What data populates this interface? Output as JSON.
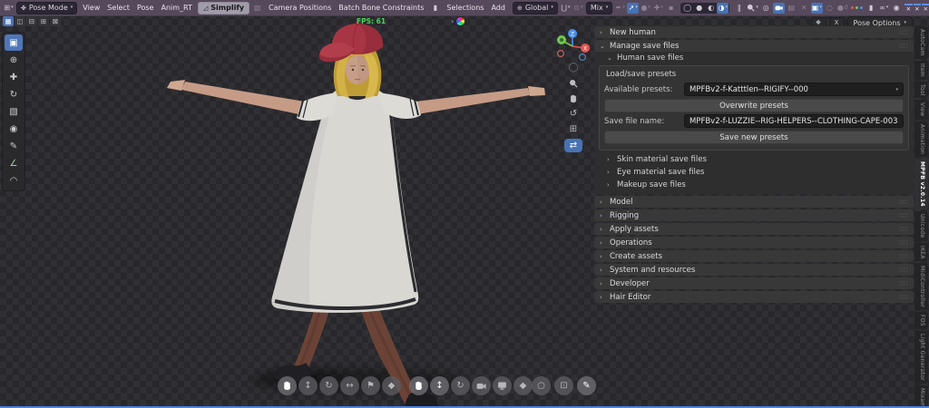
{
  "colors": {
    "accent_blue": "#4772b3",
    "header_bg": "#57495c",
    "fps_green": "#4bd45c",
    "viewport_checker_dark": "#28282c",
    "viewport_checker_light": "#303034",
    "panel_section_bg": "#383838",
    "bottom_edge_blue": "#4d82dd",
    "cap_red": "#a83543",
    "hair_blonde": "#d2b246",
    "dress_white": "#d8d7d2"
  },
  "glyphs": {
    "caret": "▾",
    "collapsed": "›",
    "expanded": "⌄"
  },
  "header": {
    "editor_icon": {
      "name": "editor-type-icon",
      "glyph": "⊞",
      "caret": true
    },
    "mode_label": "Pose Mode",
    "mode_icon_glyph": "✤",
    "menus": [
      "View",
      "Select",
      "Pose",
      "Anim_RT"
    ],
    "simplify_label": "Simplify",
    "simplify_icon_glyph": "◿",
    "menus2": [
      "Camera Positions",
      "Batch Bone Constraints"
    ],
    "bookmark_glyph": "▮",
    "menus3": [
      "Selections",
      "Add"
    ],
    "orientation_label": "Global",
    "orientation_icon_glyph": "⊕",
    "mix_label": "Mix",
    "icons_a": [
      {
        "name": "snap-magnet-icon",
        "glyph": "⋃",
        "caret": true
      },
      {
        "name": "proportional-edit-icon",
        "glyph": "⊙",
        "dim": true,
        "caret": true
      }
    ],
    "icons_b": [
      {
        "name": "eyedropper-icon",
        "glyph": "✒",
        "dim": true,
        "caret": true
      },
      {
        "name": "gizmo-toggle-icon",
        "glyph": "➚",
        "active": true,
        "caret": true
      },
      {
        "name": "sphere-icon",
        "glyph": "●",
        "dim": true,
        "caret": true
      },
      {
        "name": "overlay-cross-icon",
        "glyph": "✚",
        "dim": true,
        "caret": true
      },
      {
        "name": "disabled-box-icon",
        "glyph": "▪",
        "dim": true
      }
    ],
    "shading": [
      {
        "name": "shading-wireframe-icon",
        "glyph": "◯"
      },
      {
        "name": "shading-solid-icon",
        "glyph": "●"
      },
      {
        "name": "shading-material-icon",
        "glyph": "◐"
      },
      {
        "name": "shading-rendered-icon",
        "glyph": "◑",
        "active": true,
        "caret": true
      }
    ],
    "icons_c": [
      {
        "name": "pause-icon",
        "glyph": "‖"
      },
      {
        "name": "zoom-region-icon",
        "glyph": "svg:magnifier",
        "caret": true
      },
      {
        "name": "crosshair-icon",
        "glyph": "◎"
      },
      {
        "name": "camera-view-icon",
        "glyph": "svg:camera",
        "active": true
      },
      {
        "name": "scene-strip-icon",
        "glyph": "▤",
        "dim": true
      },
      {
        "name": "close-x-icon",
        "glyph": "✕",
        "dim": true
      },
      {
        "name": "image-overlay-icon",
        "glyph": "▣",
        "active": true,
        "caret": true
      },
      {
        "name": "circle-icon",
        "glyph": "○",
        "dim": true
      },
      {
        "name": "sphere-zero-icon",
        "glyph": "●",
        "suffix": "0",
        "dim": true
      },
      {
        "name": "rgb-axis-icon",
        "glyph": "rgb"
      },
      {
        "name": "bookmark-icon",
        "glyph": "▮"
      },
      {
        "name": "link-icon",
        "glyph": "∞",
        "caret": true
      },
      {
        "name": "overlays-icon",
        "glyph": "◉"
      }
    ],
    "x_toggles": [
      {
        "style": "blue"
      },
      {
        "style": "blue"
      },
      {
        "style": "blue"
      },
      {
        "style": "blue"
      },
      {
        "style": "blue"
      },
      {
        "style": "blue"
      },
      {
        "style": "dotted"
      },
      {
        "style": "gray"
      }
    ]
  },
  "toolbar_row2": {
    "mode_icons": [
      {
        "name": "select-set-icon",
        "glyph": "▦",
        "active": true
      },
      {
        "name": "select-extend-icon",
        "glyph": "◫"
      },
      {
        "name": "select-subtract-icon",
        "glyph": "⊟"
      },
      {
        "name": "select-invert-icon",
        "glyph": "⊞"
      },
      {
        "name": "select-intersect-icon",
        "glyph": "⊠"
      }
    ],
    "fps_label": "FPS: 61",
    "redo_chevron": "›",
    "badge1": "❖",
    "badge2": "X",
    "pose_options_label": "Pose Options"
  },
  "left_toolbar": [
    {
      "name": "tool-select-box",
      "glyph": "▣",
      "active": true
    },
    {
      "name": "tool-cursor",
      "glyph": "⊕"
    },
    {
      "name": "tool-move",
      "glyph": "✚"
    },
    {
      "name": "tool-rotate",
      "glyph": "↻"
    },
    {
      "name": "tool-scale",
      "glyph": "▧"
    },
    {
      "name": "tool-transform",
      "glyph": "◉"
    },
    {
      "name": "tool-annotate",
      "glyph": "✎"
    },
    {
      "name": "tool-measure",
      "glyph": "∠",
      "color": "#8fd6a0"
    },
    {
      "name": "tool-pose-breakdowner",
      "glyph": "◠"
    }
  ],
  "nav_icons": [
    {
      "name": "nav-orbit-circle-icon",
      "glyph": "◯",
      "dim": true
    },
    {
      "name": "nav-zoom-icon",
      "glyph": "svg:magnifier"
    },
    {
      "name": "nav-pan-hand-icon",
      "glyph": "svg:hand"
    },
    {
      "name": "nav-rotate-icon",
      "glyph": "↺"
    },
    {
      "name": "nav-grid-icon",
      "glyph": "⊞"
    },
    {
      "name": "nav-addon-toggle-button",
      "glyph": "⇄",
      "active": true
    }
  ],
  "bottom_controls": {
    "group1": [
      {
        "name": "pan-hand-button",
        "glyph": "svg:hand",
        "bright": true
      },
      {
        "name": "move-vertical-button",
        "glyph": "↕"
      },
      {
        "name": "rotate-button",
        "glyph": "↻"
      },
      {
        "name": "scale-button",
        "glyph": "↔",
        "rot": true
      },
      {
        "name": "walk-navigation-button",
        "glyph": "⚑"
      },
      {
        "name": "gizmo-diamond-button",
        "glyph": "◆"
      }
    ],
    "group2": [
      {
        "name": "pan-hand-button-2",
        "glyph": "svg:hand",
        "bright": true
      },
      {
        "name": "move-vertical-button-2",
        "glyph": "↕",
        "bright": true
      },
      {
        "name": "rotate-button-2",
        "glyph": "↻"
      },
      {
        "name": "camera-button",
        "glyph": "svg:camera"
      },
      {
        "name": "display-button",
        "glyph": "svg:monitor"
      },
      {
        "name": "gizmo-diamond-button-2",
        "glyph": "◆"
      }
    ],
    "group3": [
      {
        "name": "circle-select-button",
        "glyph": "○"
      },
      {
        "name": "frame-region-button",
        "glyph": "⊡"
      },
      {
        "name": "annotate-pen-button",
        "glyph": "✎",
        "bright": true
      }
    ]
  },
  "panel": {
    "new_human_label": "New human",
    "manage_label": "Manage save files",
    "human_save_label": "Human save files",
    "box_title": "Load/save presets",
    "available_label": "Available presets:",
    "available_value": "MPFBv2-f-Katttlen--RIGIFY--000",
    "overwrite_button": "Overwrite presets",
    "savename_label": "Save file name:",
    "savename_value": "MPFBv2-f-LUZZIE--RIG-HELPERS--CLOTHING-CAPE-003",
    "save_button": "Save new presets",
    "sub_collapsed": [
      "Skin material save files",
      "Eye material save files",
      "Makeup save files"
    ],
    "sections_bottom": [
      "Model",
      "Rigging",
      "Apply assets",
      "Operations",
      "Create assets",
      "System and resources",
      "Developer",
      "Hair Editor"
    ]
  },
  "side_tabs": [
    {
      "label": "AutoCam"
    },
    {
      "label": "Item"
    },
    {
      "label": "Tool"
    },
    {
      "label": "View"
    },
    {
      "label": "Animation"
    },
    {
      "label": "MPFB v2.0.14",
      "active": true
    },
    {
      "label": "Unicode"
    },
    {
      "label": "IKEA"
    },
    {
      "label": "MidiController"
    },
    {
      "label": "FOS"
    },
    {
      "label": "Light Generator"
    },
    {
      "label": "Mixamo"
    }
  ]
}
